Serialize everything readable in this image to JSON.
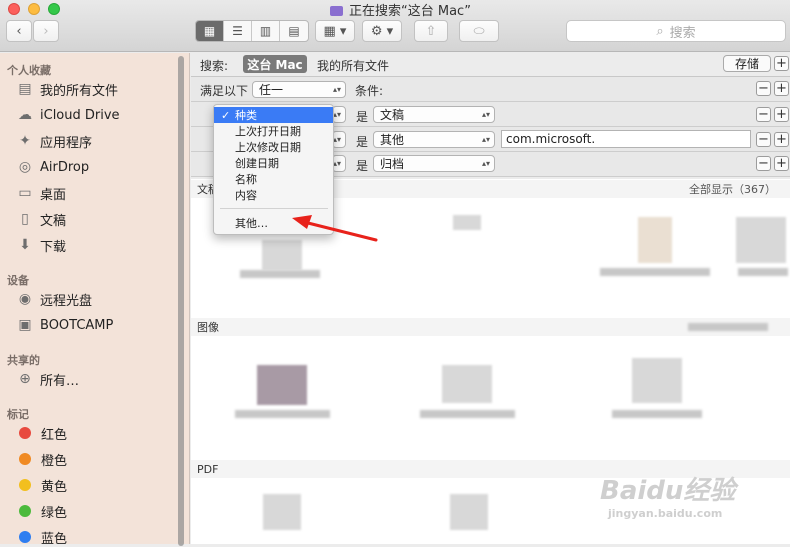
{
  "window": {
    "title": "正在搜索“这台 Mac”"
  },
  "toolbar": {
    "search_placeholder": "搜索",
    "back_icon": "chevron-left-icon",
    "forward_icon": "chevron-right-icon"
  },
  "sidebar": {
    "sections": [
      {
        "title": "个人收藏",
        "items": [
          {
            "label": "我的所有文件",
            "icon": "all-files-icon"
          },
          {
            "label": "iCloud Drive",
            "icon": "cloud-icon"
          },
          {
            "label": "应用程序",
            "icon": "applications-icon"
          },
          {
            "label": "AirDrop",
            "icon": "airdrop-icon"
          },
          {
            "label": "桌面",
            "icon": "desktop-icon"
          },
          {
            "label": "文稿",
            "icon": "documents-icon"
          },
          {
            "label": "下载",
            "icon": "download-icon"
          }
        ]
      },
      {
        "title": "设备",
        "items": [
          {
            "label": "远程光盘",
            "icon": "disc-icon"
          },
          {
            "label": "BOOTCAMP",
            "icon": "drive-icon"
          }
        ]
      },
      {
        "title": "共享的",
        "items": [
          {
            "label": "所有…",
            "icon": "network-icon"
          }
        ]
      },
      {
        "title": "标记",
        "items": [
          {
            "label": "红色",
            "color": "#e84a3f"
          },
          {
            "label": "橙色",
            "color": "#f08a23"
          },
          {
            "label": "黄色",
            "color": "#f2bf1e"
          },
          {
            "label": "绿色",
            "color": "#4cba3c"
          },
          {
            "label": "蓝色",
            "color": "#2f7ef0"
          }
        ]
      }
    ]
  },
  "scope": {
    "label": "搜索:",
    "this_mac": "这台 Mac",
    "my_files": "我的所有文件",
    "save": "存储"
  },
  "criteria": {
    "match_label": "满足以下",
    "match_value": "任一",
    "conditions_label": "条件:",
    "rows": [
      {
        "is": "是",
        "value": "文稿"
      },
      {
        "is": "是",
        "value": "其他",
        "text": "com.microsoft."
      },
      {
        "is": "是",
        "value": "归档"
      }
    ]
  },
  "menu": {
    "items": [
      "种类",
      "上次打开日期",
      "上次修改日期",
      "创建日期",
      "名称",
      "内容"
    ],
    "selected": "种类",
    "other": "其他…"
  },
  "results": {
    "sections": [
      {
        "title": "文稿",
        "show_all": "全部显示（367）"
      },
      {
        "title": "图像"
      },
      {
        "title": "PDF"
      }
    ]
  },
  "watermark": {
    "brand": "Baidu经验",
    "url": "jingyan.baidu.com"
  }
}
